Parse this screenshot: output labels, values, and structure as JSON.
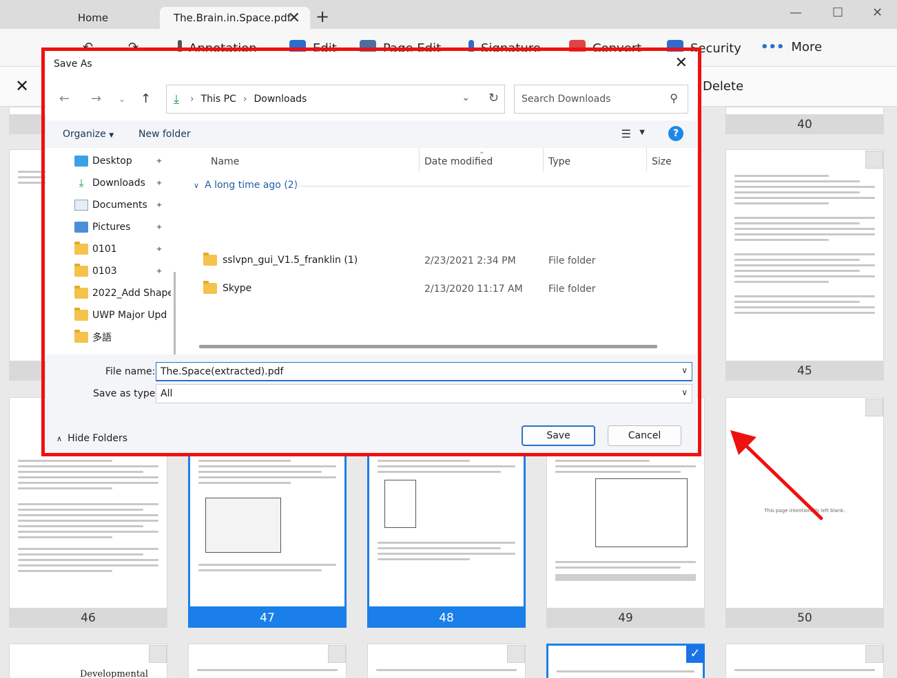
{
  "app": {
    "tabs": [
      {
        "label": "Home"
      },
      {
        "label": "The.Brain.in.Space.pdf"
      }
    ],
    "ribbon": [
      "Annotation",
      "Edit",
      "Page Edit",
      "Signature",
      "Convert",
      "Security",
      "More"
    ],
    "toolbar": {
      "delete_label": "Delete"
    }
  },
  "thumbnails": {
    "page_numbers": [
      "40",
      "45",
      "46",
      "47",
      "48",
      "49",
      "50"
    ],
    "blank_page_text": "This page intentionally left blank.",
    "bottom_titles": [
      "Developmental"
    ]
  },
  "dialog": {
    "title": "Save As",
    "breadcrumb": [
      "This PC",
      "Downloads"
    ],
    "search_placeholder": "Search Downloads",
    "commands": {
      "organize": "Organize",
      "new_folder": "New folder"
    },
    "nav_items": [
      {
        "label": "Desktop",
        "icon": "desktop-icon",
        "pinned": true
      },
      {
        "label": "Downloads",
        "icon": "download-icon",
        "pinned": true
      },
      {
        "label": "Documents",
        "icon": "documents-icon",
        "pinned": true
      },
      {
        "label": "Pictures",
        "icon": "pictures-icon",
        "pinned": true
      },
      {
        "label": "0101",
        "icon": "folder-icon",
        "pinned": true
      },
      {
        "label": "0103",
        "icon": "folder-icon",
        "pinned": true
      },
      {
        "label": "2022_Add Shape",
        "icon": "folder-icon",
        "pinned": false
      },
      {
        "label": "UWP Major Upd",
        "icon": "folder-icon",
        "pinned": false
      },
      {
        "label": "多語",
        "icon": "folder-icon",
        "pinned": false
      }
    ],
    "columns": {
      "name": "Name",
      "date": "Date modified",
      "type": "Type",
      "size": "Size"
    },
    "group_label": "A long time ago (2)",
    "files": [
      {
        "name": "sslvpn_gui_V1.5_franklin (1)",
        "date": "2/23/2021 2:34 PM",
        "type": "File folder"
      },
      {
        "name": "Skype",
        "date": "2/13/2020 11:17 AM",
        "type": "File folder"
      }
    ],
    "file_name_label": "File name:",
    "file_name_value": "The.Space(extracted).pdf",
    "save_type_label": "Save as type:",
    "save_type_value": "All",
    "hide_folders_label": "Hide Folders",
    "save_label": "Save",
    "cancel_label": "Cancel"
  },
  "colors": {
    "highlight": "#ee1111",
    "accent": "#1a7fe8"
  }
}
